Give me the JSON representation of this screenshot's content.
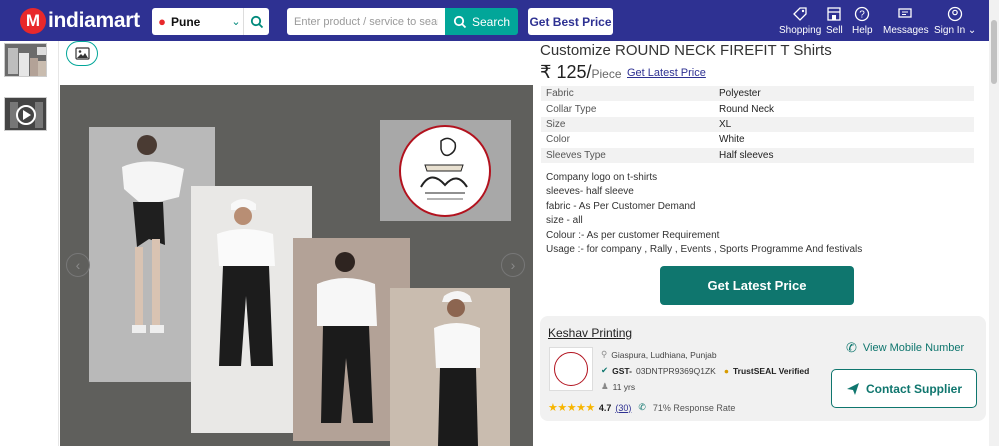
{
  "header": {
    "logo_text": "indiamart",
    "logo_mark": "M",
    "city": "Pune",
    "search_placeholder": "Enter product / service to search",
    "search_button": "Search",
    "best_price_button": "Get Best Price",
    "nav": [
      {
        "label": "Shopping",
        "icon": "tag-icon"
      },
      {
        "label": "Sell",
        "icon": "store-icon"
      },
      {
        "label": "Help",
        "icon": "help-icon"
      },
      {
        "label": "Messages",
        "icon": "messages-icon"
      },
      {
        "label": "Sign In",
        "icon": "user-icon"
      }
    ]
  },
  "gallery": {
    "thumbnails": [
      "image",
      "video"
    ],
    "nav_prev": "‹",
    "nav_next": "›"
  },
  "product": {
    "title": "Customize ROUND NECK FIREFIT T Shirts",
    "price": "₹ 125/",
    "price_unit": "Piece",
    "price_link": "Get Latest Price",
    "specs": [
      {
        "key": "Fabric",
        "value": "Polyester"
      },
      {
        "key": "Collar Type",
        "value": "Round Neck"
      },
      {
        "key": "Size",
        "value": "XL"
      },
      {
        "key": "Color",
        "value": "White"
      },
      {
        "key": "Sleeves Type",
        "value": "Half sleeves"
      }
    ],
    "description": [
      "Company logo on t-shirts",
      "sleeves- half sleeve",
      "fabric - As Per Customer Demand",
      "size - all",
      "Colour :- As per customer Requirement",
      "Usage :- for company , Rally , Events , Sports Programme And festivals"
    ],
    "cta": "Get Latest Price"
  },
  "supplier": {
    "name": "Keshav Printing",
    "location": "Giaspura, Ludhiana, Punjab",
    "gst_label": "GST-",
    "gst_number": "03DNTPR9369Q1ZK",
    "trustseal": "TrustSEAL Verified",
    "years": "11 yrs",
    "rating": "4.7",
    "rating_count": "(30)",
    "response_rate": "71% Response Rate",
    "view_mobile": "View Mobile Number",
    "contact_button": "Contact Supplier"
  },
  "colors": {
    "header_bg": "#2e3192",
    "accent_teal": "#0f766e",
    "search_teal": "#02a699",
    "logo_red": "#e8282b"
  }
}
